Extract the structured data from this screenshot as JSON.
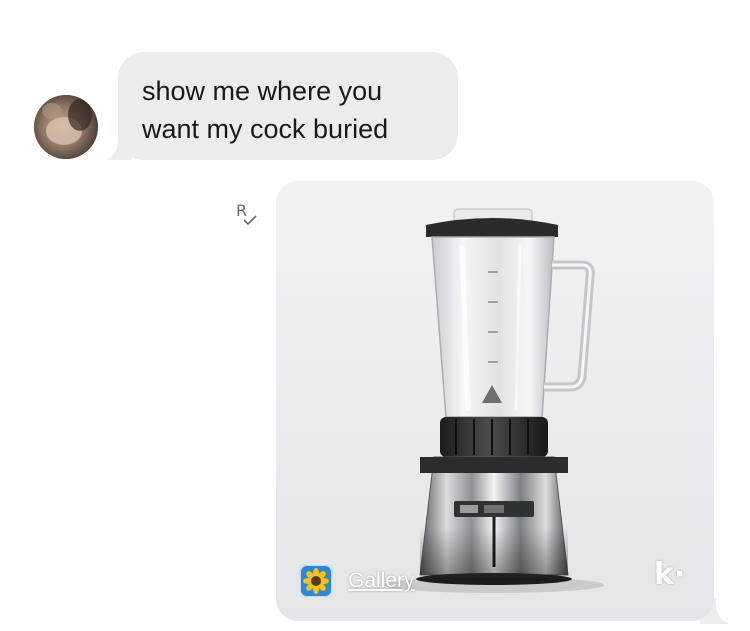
{
  "conversation": {
    "incoming_message": {
      "lines": [
        "show me where you",
        "want my cock buried"
      ]
    },
    "read_receipt": {
      "letter": "R"
    },
    "outgoing_image": {
      "subject_icon": "blender-photo",
      "source_label": "Gallery",
      "source_icon": "sunflower-icon",
      "app_mark": "k·"
    }
  },
  "colors": {
    "incoming_bubble": "#ececec",
    "outgoing_bubble": "#eceef0",
    "gallery_icon_bg": "#2f86d6"
  }
}
